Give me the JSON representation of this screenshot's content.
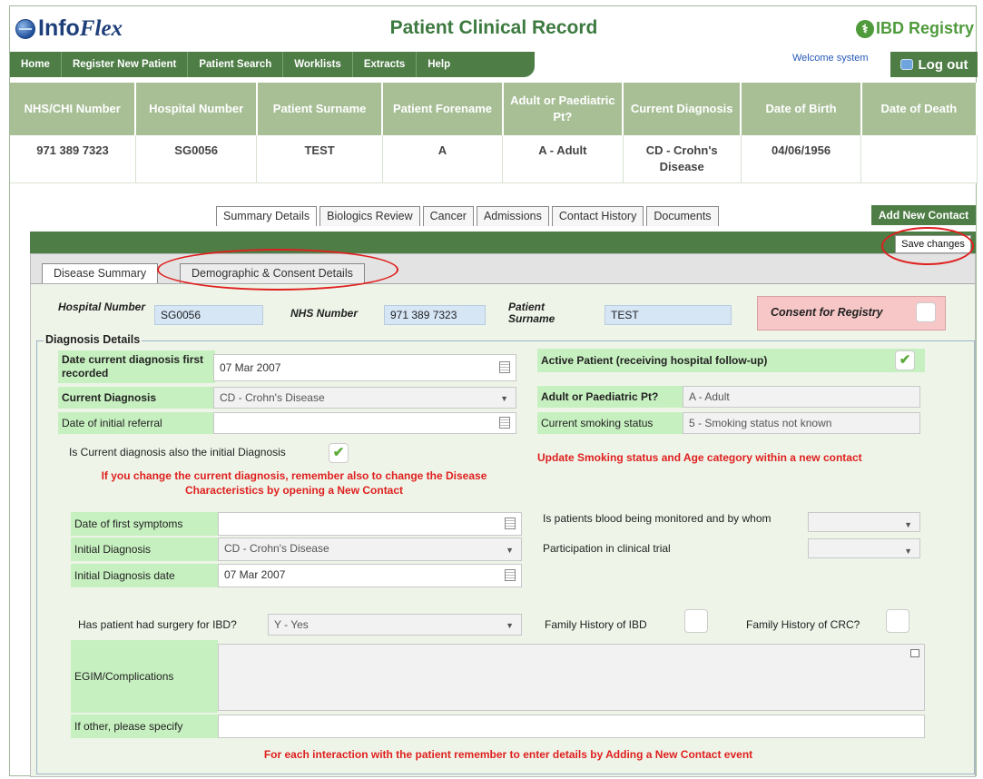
{
  "header": {
    "logo_info": "Info",
    "logo_flex": "Flex",
    "title": "Patient Clinical Record",
    "registry": "IBD Registry",
    "registry_icon": "ibd-logo-icon"
  },
  "nav": {
    "items": [
      "Home",
      "Register New Patient",
      "Patient Search",
      "Worklists",
      "Extracts",
      "Help"
    ],
    "welcome": "Welcome system",
    "logout": "Log out"
  },
  "patient": {
    "headers": [
      "NHS/CHI Number",
      "Hospital Number",
      "Patient Surname",
      "Patient Forename",
      "Adult or Paediatric Pt?",
      "Current Diagnosis",
      "Date of Birth",
      "Date of Death"
    ],
    "values": [
      "971 389 7323",
      "SG0056",
      "TEST",
      "A",
      "A - Adult",
      "CD - Crohn's Disease",
      "04/06/1956",
      ""
    ]
  },
  "tabs": [
    "Summary Details",
    "Biologics Review",
    "Cancer",
    "Admissions",
    "Contact History",
    "Documents"
  ],
  "add_contact": "Add New Contact",
  "save_changes": "Save changes",
  "subtabs": [
    "Disease Summary",
    "Demographic & Consent Details"
  ],
  "top_fields": {
    "hospital_label": "Hospital Number",
    "hospital_value": "SG0056",
    "nhs_label": "NHS Number",
    "nhs_value": "971 389 7323",
    "surname_label": "Patient Surname",
    "surname_value": "TEST",
    "consent_label": "Consent for Registry"
  },
  "diagnosis": {
    "legend": "Diagnosis Details",
    "date_first_recorded_label": "Date current diagnosis first recorded",
    "date_first_recorded_value": "07 Mar 2007",
    "current_diagnosis_label": "Current Diagnosis",
    "current_diagnosis_value": "CD - Crohn's Disease",
    "initial_referral_label": "Date of initial referral",
    "initial_referral_value": "",
    "is_initial_label": "Is Current diagnosis also the initial Diagnosis",
    "warning_change": "If you change the current diagnosis, remember also to change the Disease Characteristics by opening a New Contact",
    "active_patient_label": "Active Patient (receiving hospital follow-up)",
    "adult_paed_label": "Adult or Paediatric Pt?",
    "adult_paed_value": "A - Adult",
    "smoking_label": "Current smoking status",
    "smoking_value": "5 - Smoking status not known",
    "warning_smoking": "Update Smoking status and Age category within a new contact",
    "first_symptoms_label": "Date of first symptoms",
    "first_symptoms_value": "",
    "initial_diag_label": "Initial Diagnosis",
    "initial_diag_value": "CD - Crohn's Disease",
    "initial_diag_date_label": "Initial Diagnosis date",
    "initial_diag_date_value": "07 Mar 2007",
    "blood_monitored_label": "Is patients blood being monitored and by whom",
    "clinical_trial_label": "Participation in clinical trial",
    "surgery_label": "Has patient had surgery for IBD?",
    "surgery_value": "Y - Yes",
    "family_ibd_label": "Family History of IBD",
    "family_crc_label": "Family History of CRC?",
    "egim_label": "EGIM/Complications",
    "other_label": "If other, please specify",
    "warning_contact": "For each interaction with the patient remember to enter details by Adding a New Contact event"
  },
  "checkmark": "✔",
  "dropdown_glyph": "▼"
}
